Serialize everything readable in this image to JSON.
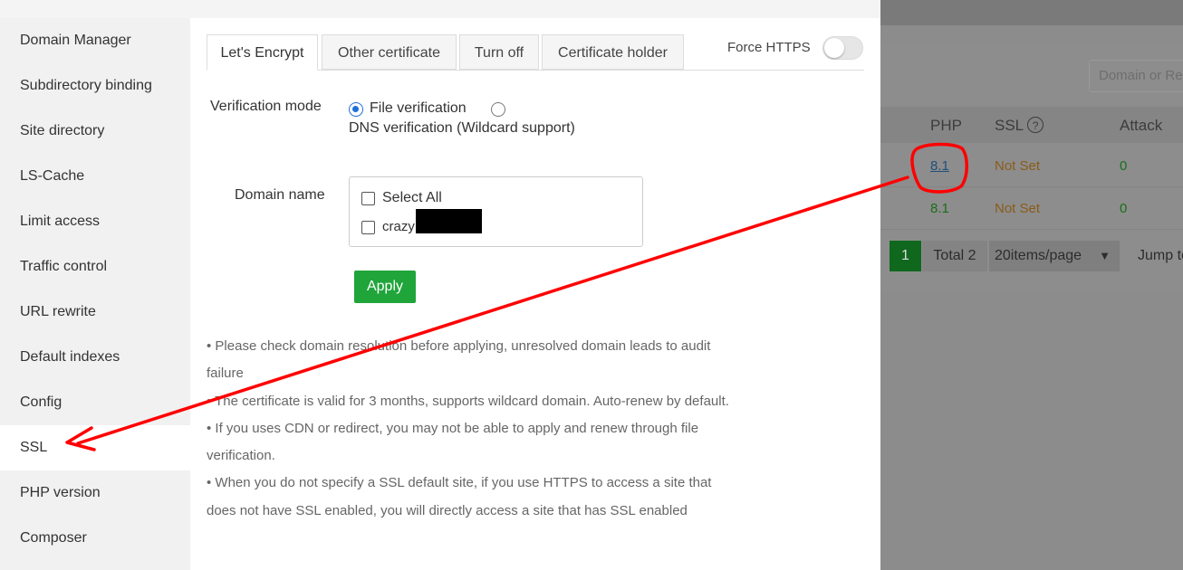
{
  "background": {
    "search_placeholder": "Domain or Re",
    "columns": {
      "php": "PHP",
      "ssl": "SSL",
      "ssl_help": "?",
      "attack": "Attack"
    },
    "rows": [
      {
        "php": "8.1",
        "ssl": "Not Set",
        "attack": "0"
      },
      {
        "php": "8.1",
        "ssl": "Not Set",
        "attack": "0"
      }
    ],
    "pager": {
      "current": "1",
      "total": "Total 2",
      "per_page": "20items/page",
      "jump": "Jump to"
    }
  },
  "sidebar": {
    "items": [
      {
        "label": "Domain Manager"
      },
      {
        "label": "Subdirectory binding"
      },
      {
        "label": "Site directory"
      },
      {
        "label": "LS-Cache"
      },
      {
        "label": "Limit access"
      },
      {
        "label": "Traffic control"
      },
      {
        "label": "URL rewrite"
      },
      {
        "label": "Default indexes"
      },
      {
        "label": "Config"
      },
      {
        "label": "SSL",
        "active": true
      },
      {
        "label": "PHP version"
      },
      {
        "label": "Composer"
      }
    ]
  },
  "tabs": [
    {
      "label": "Let's Encrypt",
      "active": true
    },
    {
      "label": "Other certificate"
    },
    {
      "label": "Turn off"
    },
    {
      "label": "Certificate holder"
    }
  ],
  "force_https": {
    "label": "Force HTTPS",
    "enabled": false
  },
  "verification": {
    "label": "Verification mode",
    "options": [
      "File verification",
      "DNS verification (Wildcard support)"
    ],
    "selected": "File verification"
  },
  "domain": {
    "label": "Domain name",
    "select_all": "Select All",
    "entries": [
      "crazy"
    ]
  },
  "apply_label": "Apply",
  "notes": [
    "• Please check domain resolution before applying, unresolved domain leads to audit failure",
    "• The certificate is valid for 3 months, supports wildcard domain. Auto-renew by default.",
    "• If you uses CDN or redirect, you may not be able to apply and renew through file verification.",
    "• When you do not specify a SSL default site, if you use HTTPS to access a site that does not have SSL enabled, you will directly access a site that has SSL enabled"
  ],
  "colors": {
    "accent_green": "#20a53a",
    "radio_blue": "#1e6fd9",
    "annotation_red": "#ff0000"
  }
}
